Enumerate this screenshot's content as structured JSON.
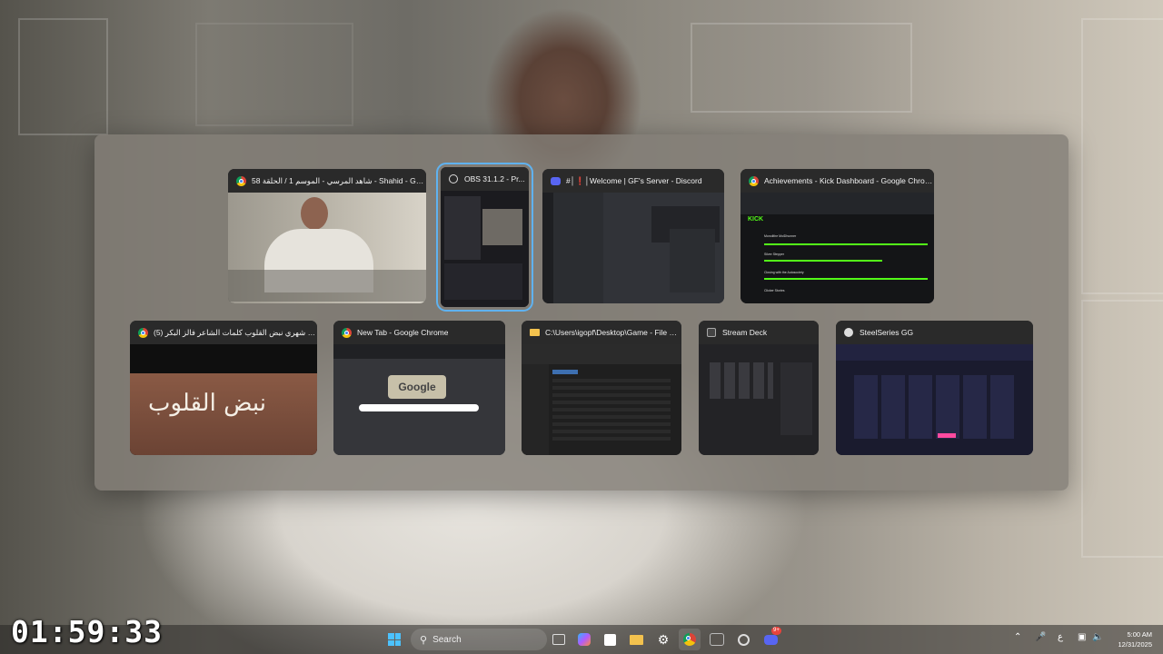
{
  "timer": "01:59:33",
  "windows": [
    {
      "id": "shahid",
      "title": "شاهد المرسي - الموسم 1 / الحلقة 58 - Shahid - Googl...",
      "icon": "chrome-icon",
      "selected": false
    },
    {
      "id": "obs",
      "title": "OBS 31.1.2 - Pr...",
      "icon": "obs-icon",
      "selected": true
    },
    {
      "id": "discord",
      "title": "#│❗│Welcome | GF's Server - Discord",
      "icon": "discord-icon",
      "selected": false
    },
    {
      "id": "kick",
      "title": "Achievements - Kick Dashboard - Google Chrome",
      "icon": "chrome-icon",
      "selected": false
    },
    {
      "id": "youtube",
      "title": "(5) لعب شهري نبض القلوب كلمات الشاعر فالز البكر...",
      "icon": "chrome-icon",
      "selected": false
    },
    {
      "id": "newtab",
      "title": "New Tab - Google Chrome",
      "icon": "chrome-icon",
      "selected": false
    },
    {
      "id": "explorer",
      "title": "C:\\Users\\igopf\\Desktop\\Game - File Ex...",
      "icon": "folder-icon",
      "selected": false
    },
    {
      "id": "streamdeck",
      "title": "Stream Deck",
      "icon": "stream-deck-icon",
      "selected": false
    },
    {
      "id": "steelseries",
      "title": "SteelSeries GG",
      "icon": "steelseries-icon",
      "selected": false
    }
  ],
  "thumb_text": {
    "kick_logo": "KICK",
    "kick_rows": [
      "Monolithe MoiDhunner",
      "Silver Stepper",
      "Closing with the Autosociety",
      "Clicker Stories"
    ],
    "google_logo": "Google",
    "youtube_calligraphy": "نبض القلوب"
  },
  "taskbar": {
    "search_placeholder": "Search",
    "discord_badge": "9+",
    "lang": "ع",
    "time": "5:00 AM",
    "date": "12/31/2025"
  }
}
